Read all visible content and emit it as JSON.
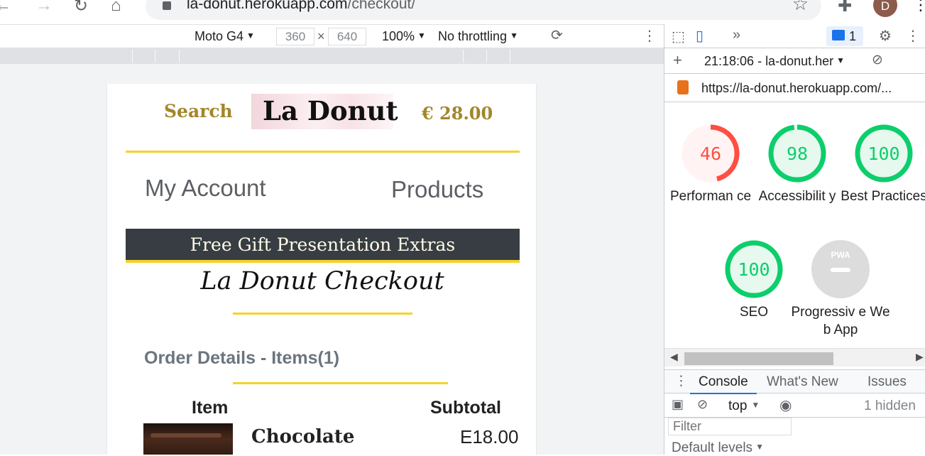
{
  "browser": {
    "url_host": "la-donut.herokuapp.com",
    "url_path": "/checkout/",
    "profile_initial": "D",
    "icons": [
      "back-arrow",
      "forward-arrow",
      "reload",
      "home",
      "lock",
      "bookmark-star",
      "extensions-puzzle",
      "more-vertical"
    ]
  },
  "device_toolbar": {
    "device": "Moto G4",
    "width": "360",
    "height": "640",
    "times": "×",
    "zoom": "100%",
    "throttling": "No throttling"
  },
  "page": {
    "search": "Search",
    "logo": "La Donut",
    "cart_total": "€ 28.00",
    "nav_account": "My Account",
    "nav_products": "Products",
    "gift_bar": "Free Gift Presentation Extras",
    "checkout_title": "La Donut Checkout",
    "order_heading": "Order Details - Items(1)",
    "col_item": "Item",
    "col_subtotal": "Subtotal",
    "product_name": "Chocolate",
    "product_price": "E18.00"
  },
  "devtools": {
    "more_tabs": "»",
    "issues_count": "1",
    "report_label": "21:18:06 - la-donut.her",
    "report_url": "https://la-donut.herokuapp.com/...",
    "gauges": [
      {
        "score": "46",
        "label": "Performan ce",
        "value": 46,
        "color": "#ff4e42",
        "bg": "#fff3f3"
      },
      {
        "score": "98",
        "label": "Accessibilit y",
        "value": 98,
        "color": "#0cce6b",
        "bg": "#e7f9ef"
      },
      {
        "score": "100",
        "label": "Best Practices",
        "value": 100,
        "color": "#0cce6b",
        "bg": "#e7f9ef"
      },
      {
        "score": "100",
        "label": "SEO",
        "value": 100,
        "color": "#0cce6b",
        "bg": "#e7f9ef"
      }
    ],
    "pwa": {
      "badge": "PWA",
      "label": "Progressiv e Web App"
    },
    "drawer_tabs": [
      "Console",
      "What's New",
      "Issues"
    ],
    "context": "top",
    "hidden_count": "1 hidden",
    "filter_placeholder": "Filter",
    "levels": "Default levels"
  }
}
